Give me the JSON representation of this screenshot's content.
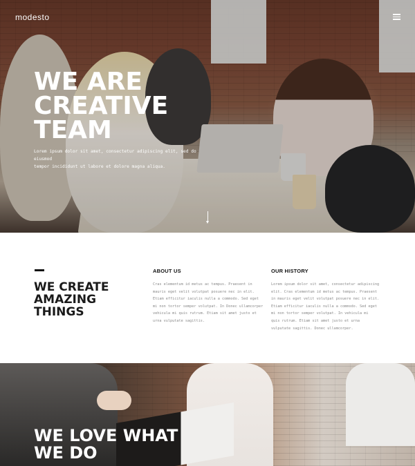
{
  "header": {
    "logo": "modesto",
    "menu_icon": "hamburger-menu-icon"
  },
  "hero": {
    "title_lines": [
      "WE ARE",
      "CREATIVE",
      "TEAM"
    ],
    "subtitle_lines": [
      "Lorem ipsum dolor sit amet, consectetur adipiscing elit, sed do eiusmod",
      "tempor incididunt ut labore et dolore magna aliqua."
    ],
    "scroll_icon": "arrow-down-icon"
  },
  "about": {
    "title_lines": [
      "WE CREATE",
      "AMAZING",
      "THINGS"
    ],
    "about_us": {
      "heading": "ABOUT US",
      "lines": [
        "Cras elementum id metus ac tempus. Praesent in",
        "mauris eget velit volutpat posuere nec in elit.",
        "Etiam efficitur iaculis nulla a commodo. Sed eget",
        "mi non tortor semper volutpat. In Donec ullamcorper",
        "vehicula mi quis rutrum. Etiam sit amet justo et",
        "urna vulputate sagittis."
      ]
    },
    "our_history": {
      "heading": "OUR HISTORY",
      "lines": [
        "Lorem ipsum dolor sit amet, consectetur adipiscing",
        "elit. Cras elementum id metus ac tempus. Praesent",
        "in mauris eget velit volutpat posuere nec in elit.",
        "Etiam efficitur iaculis nulla a commodo. Sed eget",
        "mi non tortor semper volutpat. In vehicula mi",
        "quis rutrum. Etiam sit amet justo et urna",
        "vulputate sagittis. Donec ullamcorper."
      ]
    }
  },
  "love": {
    "title_lines": [
      "WE LOVE WHAT",
      "WE DO"
    ]
  }
}
